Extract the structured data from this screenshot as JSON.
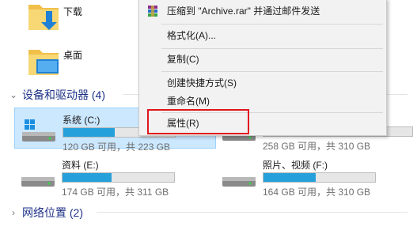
{
  "folders": [
    {
      "label": "下载",
      "icon": "downloads-folder-icon"
    },
    {
      "label": "桌面",
      "icon": "desktop-folder-icon"
    }
  ],
  "sections": {
    "devices": "设备和驱动器 (4)",
    "network": "网络位置 (2)"
  },
  "drives": [
    {
      "name": "系统 (C:)",
      "free": "120 GB 可用，共 223 GB",
      "used_fraction": 0.46,
      "selected": true,
      "icon": "windows-drive-icon"
    },
    {
      "name": "",
      "free": "258 GB 可用，共 310 GB",
      "used_fraction": 0.17,
      "selected": false,
      "icon": "hard-drive-icon"
    },
    {
      "name": "资料 (E:)",
      "free": "174 GB 可用，共 311 GB",
      "used_fraction": 0.44,
      "selected": false,
      "icon": "hard-drive-icon"
    },
    {
      "name": "照片、视频 (F:)",
      "free": "164 GB 可用，共 310 GB",
      "used_fraction": 0.47,
      "selected": false,
      "icon": "hard-drive-icon"
    }
  ],
  "context_menu": {
    "items": [
      {
        "label": "压缩到 \"Archive.rar\" 并通过邮件发送",
        "icon": "winrar-icon"
      },
      {
        "label": "格式化(A)..."
      },
      {
        "label": "复制(C)"
      },
      {
        "label": "创建快捷方式(S)"
      },
      {
        "label": "重命名(M)"
      },
      {
        "label": "属性(R)"
      }
    ]
  },
  "colors": {
    "accent": "#26a0da",
    "selection_bg": "#cce8ff",
    "highlight_border": "#e0161f",
    "section_text": "#1e3287"
  }
}
